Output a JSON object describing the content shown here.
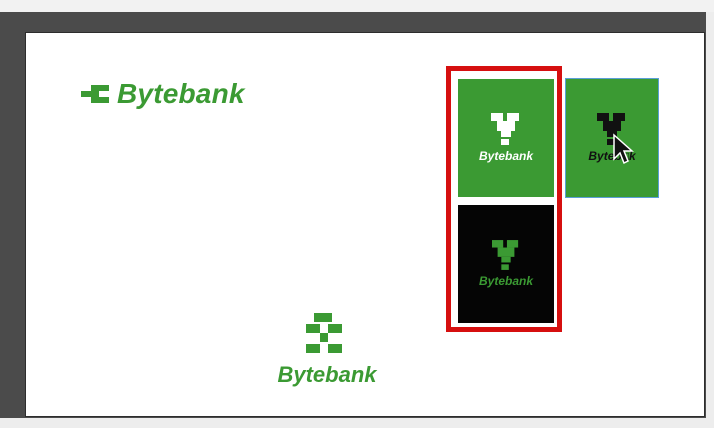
{
  "colors": {
    "brand_green": "#3b9a33",
    "brand_black": "#050505",
    "selection_red": "#d60f0f",
    "selection_blue": "#5a9fd6"
  },
  "logos": {
    "horizontal": {
      "text": "Bytebank",
      "icon": "bytebank-mark-icon"
    },
    "vertical": {
      "text": "Bytebank",
      "icon": "bytebank-mark-icon"
    },
    "tile_green": {
      "text": "Bytebank",
      "icon": "bytebank-mark-icon"
    },
    "tile_black": {
      "text": "Bytebank",
      "icon": "bytebank-mark-icon"
    },
    "tile_selected": {
      "text": "Byteb□k",
      "icon": "bytebank-mark-icon"
    }
  }
}
